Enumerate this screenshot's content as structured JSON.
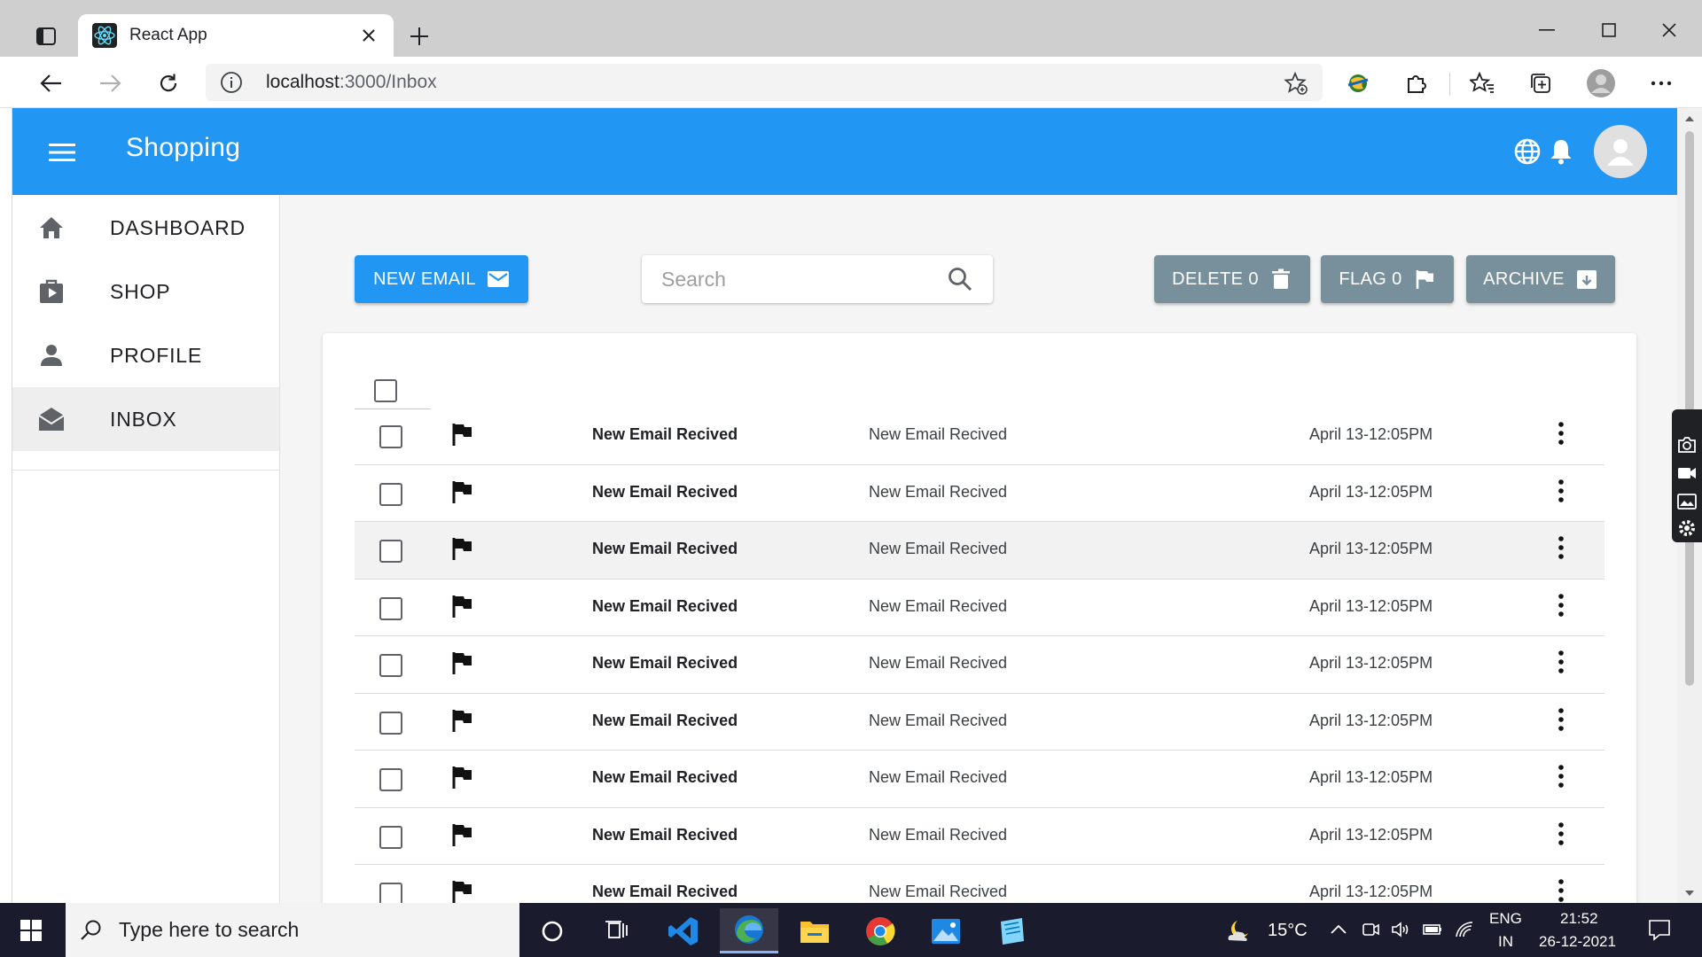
{
  "browser": {
    "tab_title": "React App",
    "url_host": "localhost",
    "url_rest": ":3000/Inbox"
  },
  "app": {
    "brand": "Shopping",
    "colors": {
      "primary": "#2196f3",
      "grey_button": "#78909c"
    }
  },
  "sidebar": {
    "items": [
      {
        "label": "DASHBOARD",
        "icon": "home-icon"
      },
      {
        "label": "SHOP",
        "icon": "shop-bag-icon"
      },
      {
        "label": "PROFILE",
        "icon": "person-icon"
      },
      {
        "label": "INBOX",
        "icon": "drafts-icon",
        "active": true
      }
    ]
  },
  "actions": {
    "new_email": "NEW EMAIL",
    "search_placeholder": "Search",
    "delete": "DELETE 0",
    "flag": "FLAG 0",
    "archive": "ARCHIVE"
  },
  "emails": [
    {
      "subject": "New Email Recived",
      "preview": "New Email Recived",
      "date": "April 13-12:05PM"
    },
    {
      "subject": "New Email Recived",
      "preview": "New Email Recived",
      "date": "April 13-12:05PM"
    },
    {
      "subject": "New Email Recived",
      "preview": "New Email Recived",
      "date": "April 13-12:05PM"
    },
    {
      "subject": "New Email Recived",
      "preview": "New Email Recived",
      "date": "April 13-12:05PM"
    },
    {
      "subject": "New Email Recived",
      "preview": "New Email Recived",
      "date": "April 13-12:05PM"
    },
    {
      "subject": "New Email Recived",
      "preview": "New Email Recived",
      "date": "April 13-12:05PM"
    },
    {
      "subject": "New Email Recived",
      "preview": "New Email Recived",
      "date": "April 13-12:05PM"
    },
    {
      "subject": "New Email Recived",
      "preview": "New Email Recived",
      "date": "April 13-12:05PM"
    },
    {
      "subject": "New Email Recived",
      "preview": "New Email Recived",
      "date": "April 13-12:05PM"
    }
  ],
  "taskbar": {
    "search_placeholder": "Type here to search",
    "temperature": "15°C",
    "lang_1": "ENG",
    "lang_2": "IN",
    "time": "21:52",
    "date": "26-12-2021"
  }
}
